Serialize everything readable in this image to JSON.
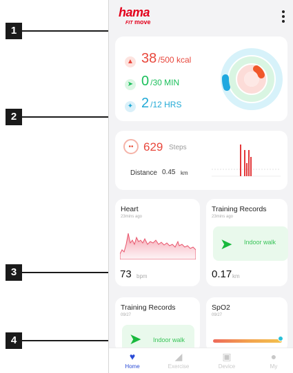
{
  "brand": {
    "logo_main": "hama",
    "logo_fit": "FIT",
    "logo_move": "move"
  },
  "menu": {
    "icon": "more-vertical-icon"
  },
  "summary": {
    "calories": {
      "icon": "flame-icon",
      "value": "38",
      "goal": "/500 kcal",
      "color": "#e8473c"
    },
    "exercise": {
      "icon": "running-icon",
      "value": "0",
      "goal": "/30 MIN",
      "color": "#1bbf5b"
    },
    "stand": {
      "icon": "walking-icon",
      "value": "2",
      "goal": "/12 HRS",
      "color": "#20a9d6"
    }
  },
  "steps": {
    "icon": "footprints-icon",
    "value": "629",
    "unit": "Steps",
    "distance_label": "Distance",
    "distance_value": "0.45",
    "distance_unit": "km"
  },
  "heart": {
    "title": "Heart",
    "subtitle": "23mins ago",
    "value": "73",
    "unit": "bpm"
  },
  "training": {
    "title": "Training Records",
    "subtitle": "23mins ago",
    "activity": "Indoor walk",
    "value": "0.17",
    "unit": "km",
    "icon": "walking-icon"
  },
  "training2": {
    "title": "Training Records",
    "subtitle": "09/27",
    "activity": "Indoor walk",
    "icon": "walking-icon"
  },
  "spo2": {
    "title": "SpO2",
    "subtitle": "09/27"
  },
  "nav": [
    {
      "label": "Home",
      "icon": "heart-icon",
      "active": true
    },
    {
      "label": "Exercise",
      "icon": "shoe-icon",
      "active": false
    },
    {
      "label": "Device",
      "icon": "watch-icon",
      "active": false
    },
    {
      "label": "My",
      "icon": "person-icon",
      "active": false
    }
  ],
  "callouts": [
    "1",
    "2",
    "3",
    "4"
  ],
  "colors": {
    "accent_red": "#e3001b",
    "calories": "#e8473c",
    "exercise": "#1bbf5b",
    "stand": "#20a9d6",
    "nav_active": "#2a4bd6",
    "nav_inactive": "#c8c8c8"
  }
}
